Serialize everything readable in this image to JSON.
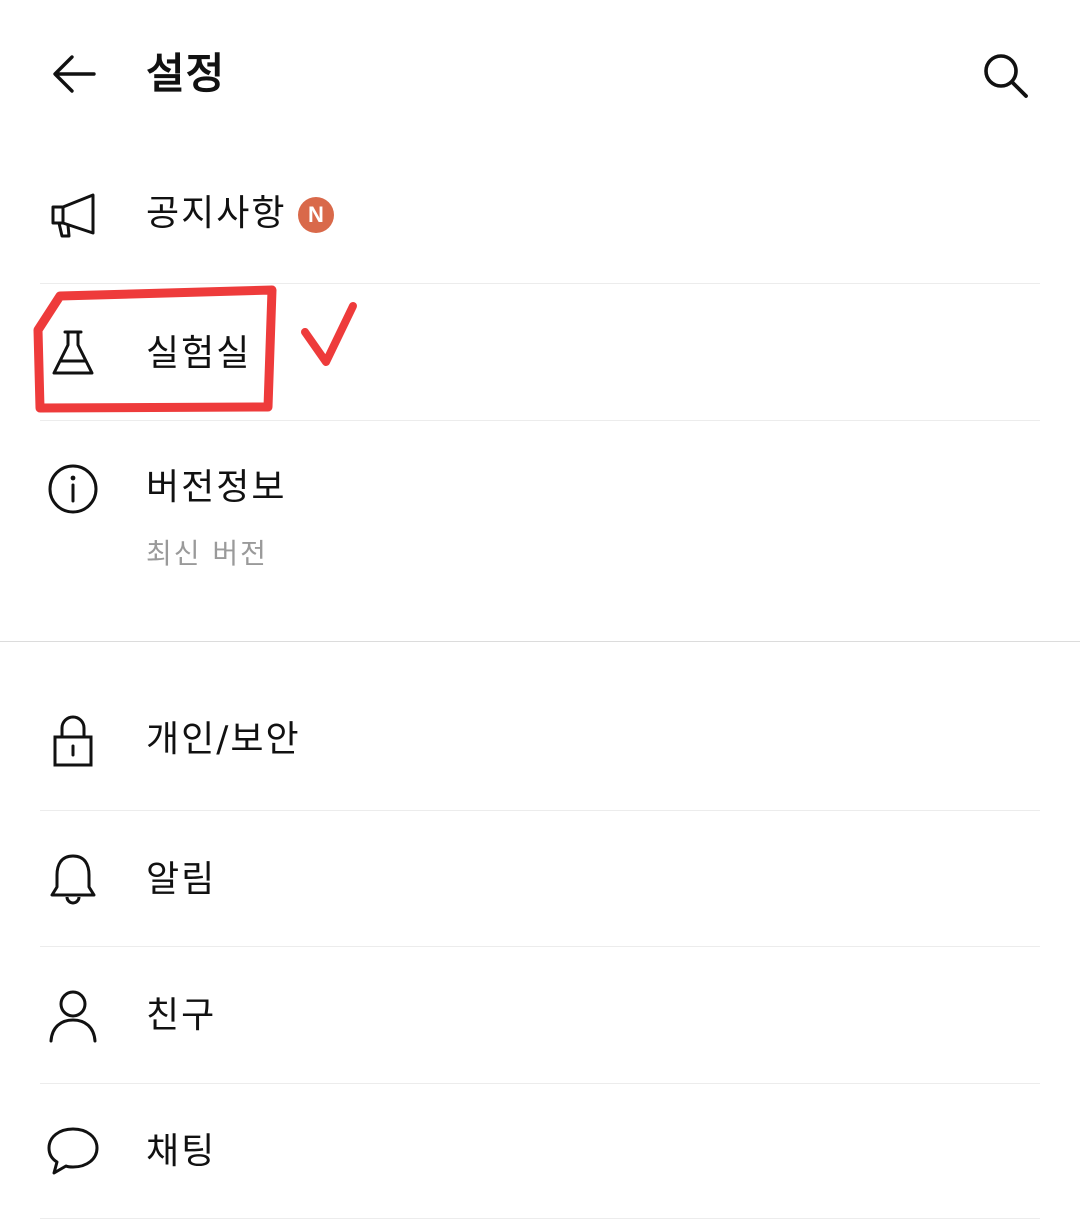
{
  "header": {
    "title": "설정",
    "back_icon": "arrow-left-icon",
    "search_icon": "search-icon"
  },
  "menu": {
    "notice": {
      "label": "공지사항",
      "icon": "megaphone-icon",
      "badge": "N",
      "badge_color": "#d9694a"
    },
    "lab": {
      "label": "실험실",
      "icon": "flask-icon"
    },
    "version": {
      "label": "버전정보",
      "icon": "info-icon",
      "status": "최신 버전"
    },
    "privacy": {
      "label": "개인/보안",
      "icon": "lock-icon"
    },
    "notifications": {
      "label": "알림",
      "icon": "bell-icon"
    },
    "friends": {
      "label": "친구",
      "icon": "person-icon"
    },
    "chat": {
      "label": "채팅",
      "icon": "chat-bubble-icon"
    }
  },
  "annotation": {
    "mark_color": "#ee3b3b",
    "highlight_target": "실험실"
  }
}
